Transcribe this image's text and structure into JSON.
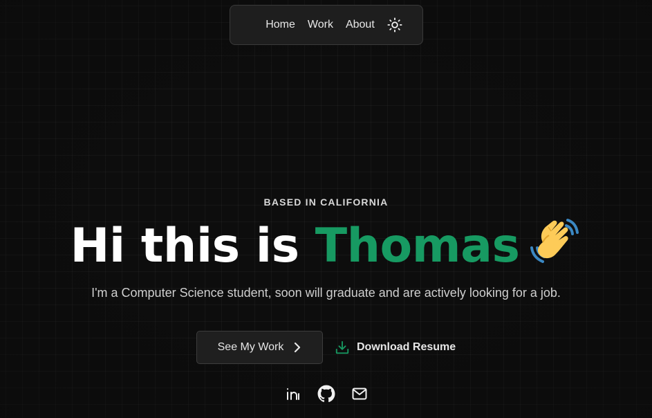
{
  "nav": {
    "items": [
      {
        "label": "Home"
      },
      {
        "label": "Work"
      },
      {
        "label": "About"
      }
    ],
    "theme_toggle_icon": "sun-icon"
  },
  "hero": {
    "eyebrow": "BASED IN CALIFORNIA",
    "headline_prefix": "Hi this is ",
    "headline_name": "Thomas",
    "headline_emoji": "waving-hand-emoji",
    "subtitle": "I'm a Computer Science student, soon will graduate and are actively looking for a job."
  },
  "actions": {
    "see_work_label": "See My Work",
    "see_work_icon": "chevron-right-icon",
    "download_label": "Download Resume",
    "download_icon": "download-icon"
  },
  "socials": [
    {
      "icon": "linkedin-icon"
    },
    {
      "icon": "github-icon"
    },
    {
      "icon": "mail-icon"
    }
  ],
  "colors": {
    "background": "#0d0d0d",
    "accent": "#179a62",
    "nav_background": "#1e1e1e",
    "text": "#e8e8e8"
  }
}
